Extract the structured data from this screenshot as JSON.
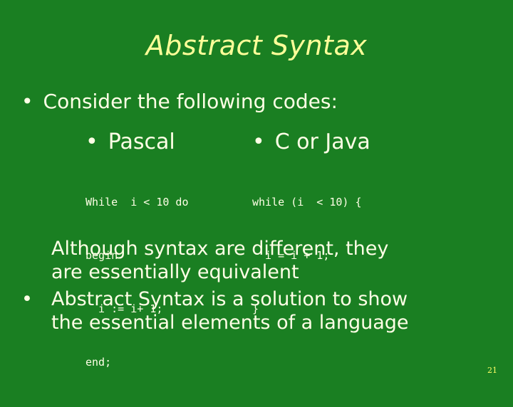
{
  "slide": {
    "background_color": "#1a7f22",
    "title_color": "#ffff99",
    "text_color": "#ffffe6",
    "title": "Abstract Syntax",
    "intro_bullet": {
      "bullet": "•",
      "text": "Consider the following codes:"
    },
    "examples": [
      {
        "bullet": "•",
        "heading": "Pascal",
        "code_lines": [
          "While  i < 10 do",
          "begin",
          "  i := i+ 1;",
          "end;"
        ]
      },
      {
        "bullet": "•",
        "heading": "C or Java",
        "code_lines": [
          "while (i  < 10) {",
          "  i = i + 1;",
          "}"
        ]
      }
    ],
    "paragraphs": [
      {
        "bullet": "",
        "lines": [
          "Although syntax are different, they",
          "are essentially equivalent"
        ]
      },
      {
        "bullet": "•",
        "lines": [
          "Abstract Syntax is a solution to show",
          "the essential elements of a language"
        ]
      }
    ],
    "page_number": "21"
  }
}
